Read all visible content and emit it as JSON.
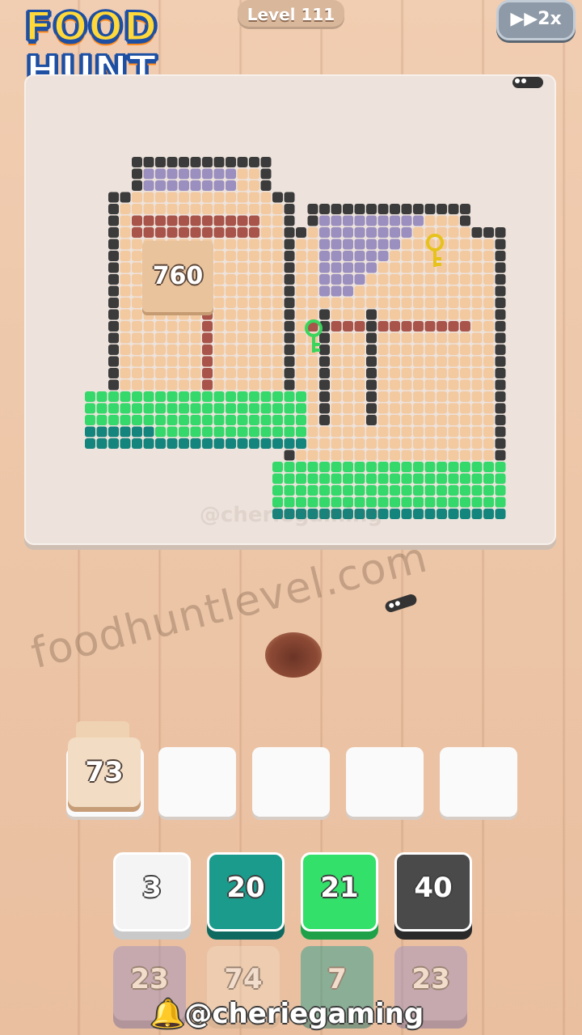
{
  "logo": {
    "line1": "FOOD",
    "line2": "HUNT"
  },
  "header": {
    "level": "Level 111",
    "speed": "2x"
  },
  "board": {
    "big_tile_value": "760",
    "watermark": "@cheriegaming"
  },
  "watermark": "foodhuntlevel.com",
  "slots": {
    "filled_value": "73",
    "filled_count": 1,
    "total": 5
  },
  "tiles_row1": [
    {
      "value": "3",
      "color": "#f4f4f4",
      "shade": "#c9c9c9"
    },
    {
      "value": "20",
      "color": "#1a9b8c",
      "shade": "#0e6a60"
    },
    {
      "value": "21",
      "color": "#33e06a",
      "shade": "#1fa14a"
    },
    {
      "value": "40",
      "color": "#4a4a4a",
      "shade": "#2a2a2a"
    }
  ],
  "tiles_row2": [
    {
      "value": "23",
      "color": "#9b8fc2",
      "shade": "#6f6396"
    },
    {
      "value": "74",
      "color": "#f2dcc3",
      "shade": "#c9a98a"
    },
    {
      "value": "7",
      "color": "#1a9b8c",
      "shade": "#0e6a60"
    },
    {
      "value": "23",
      "color": "#9b8fc2",
      "shade": "#6f6396"
    }
  ],
  "footer": {
    "handle": "@cheriegaming",
    "bell_icon": "bell-icon"
  },
  "colors": {
    "skin": "#f3c9a0",
    "outline": "#3b3b3b",
    "purple": "#9a8fbf",
    "brown": "#a8544a",
    "green": "#35d86a",
    "teal": "#14857d"
  }
}
